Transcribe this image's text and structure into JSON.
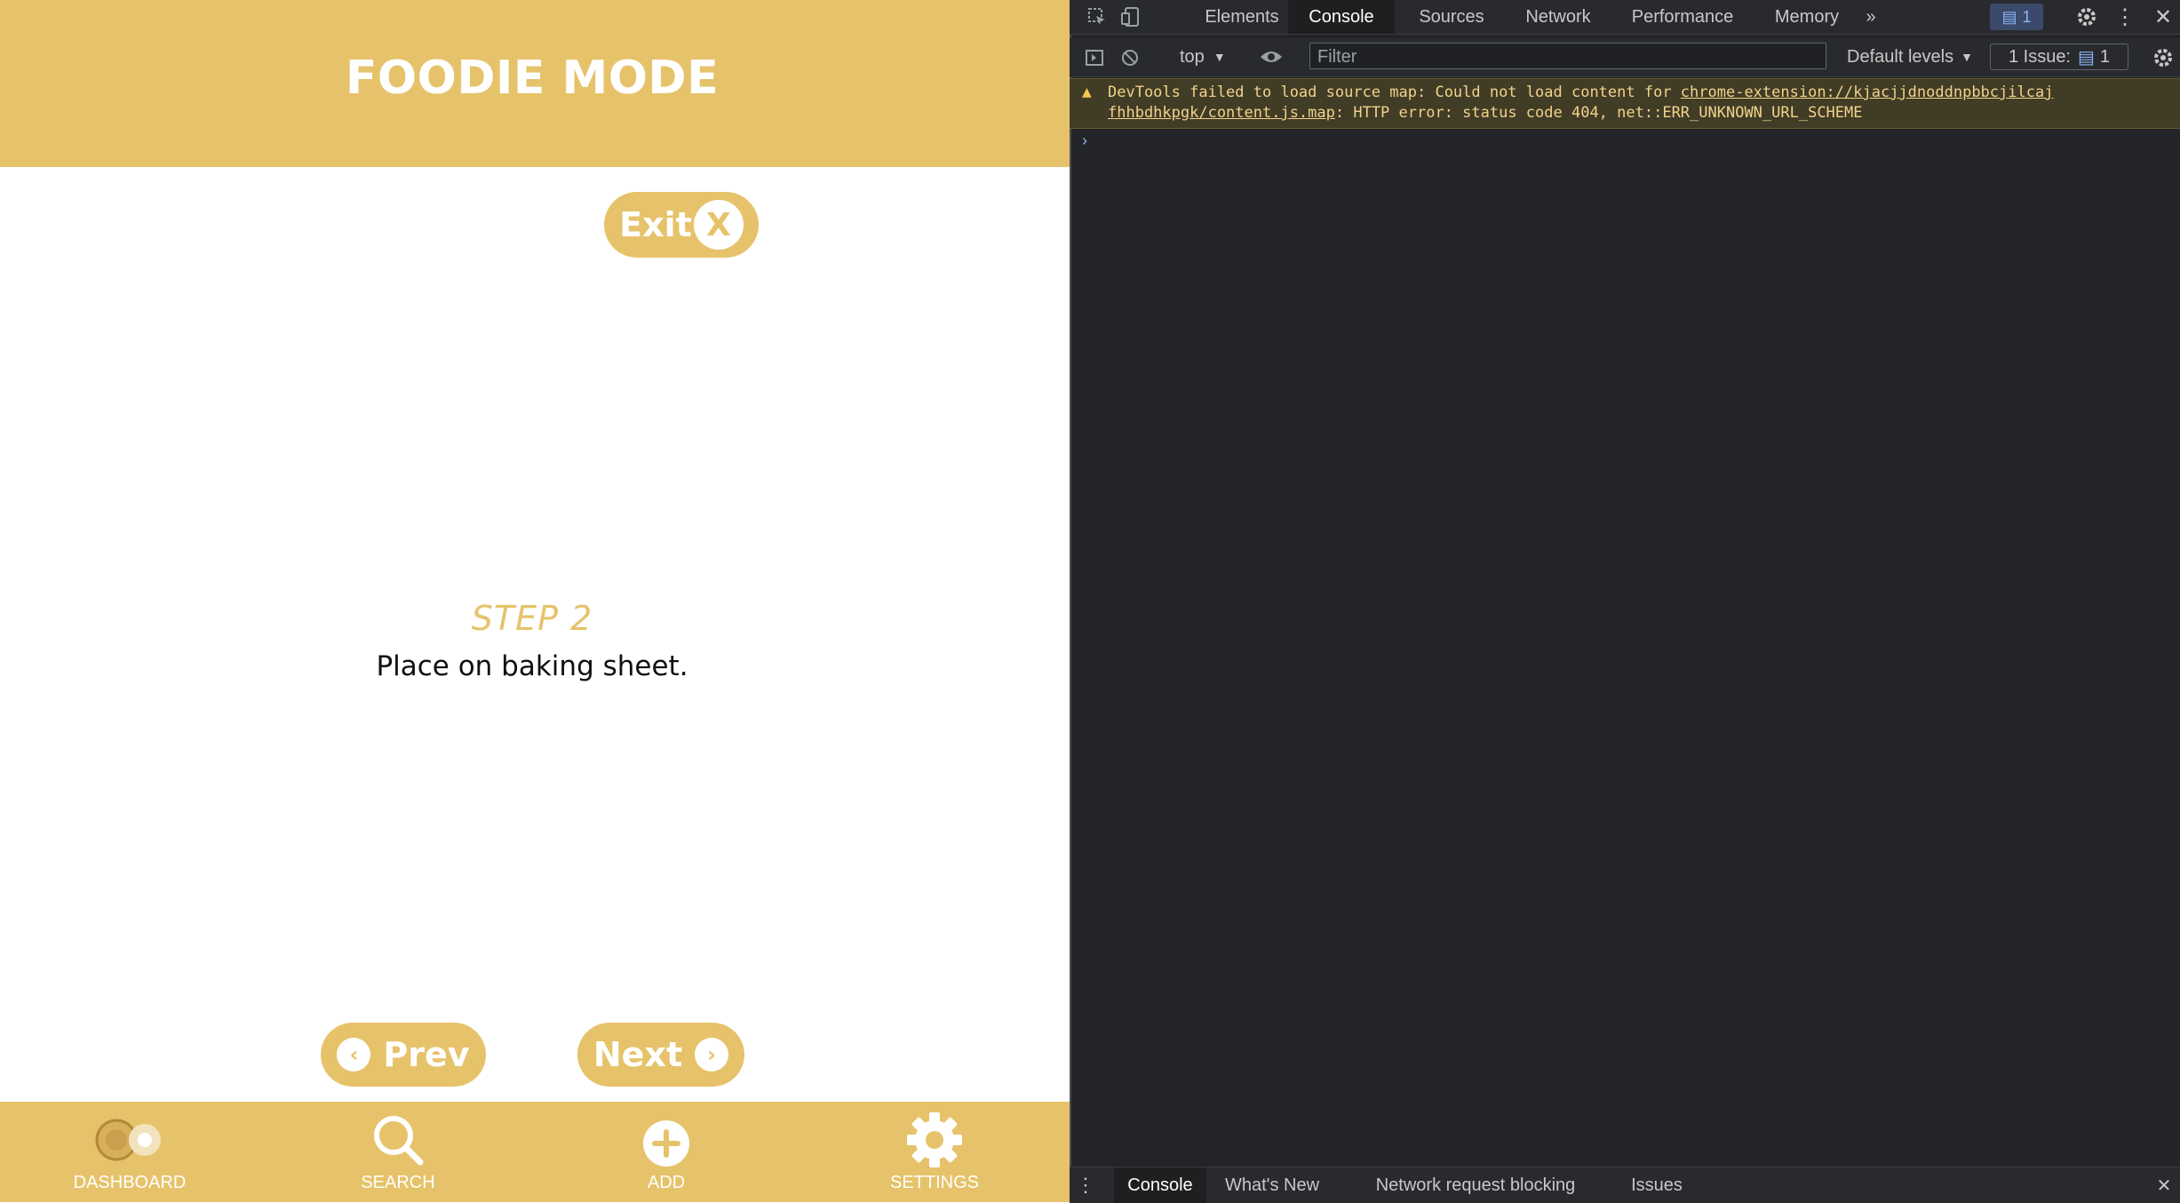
{
  "app": {
    "title": "FOODIE MODE",
    "exit_label": "Exit",
    "exit_icon": "X",
    "step_title": "STEP 2",
    "step_text": "Place on baking sheet.",
    "prev_label": "Prev",
    "next_label": "Next",
    "accent_color": "#e6c36a",
    "nav": [
      {
        "label": "DASHBOARD",
        "icon": "dashboard-icon"
      },
      {
        "label": "SEARCH",
        "icon": "search-icon"
      },
      {
        "label": "ADD",
        "icon": "add-icon"
      },
      {
        "label": "SETTINGS",
        "icon": "settings-icon"
      }
    ]
  },
  "devtools": {
    "tabs": [
      "Elements",
      "Console",
      "Sources",
      "Network",
      "Performance",
      "Memory"
    ],
    "active_tab": "Console",
    "messages_badge": "1",
    "context": "top",
    "filter_placeholder": "Filter",
    "levels": "Default levels",
    "issues_label": "1 Issue:",
    "issues_count": "1",
    "warning": {
      "prefix": "DevTools failed to load source map: Could not load content for ",
      "url_part1": "chrome-extension://kjacjjdnoddnpbbcjilcaj",
      "url_part2": "fhhbdhkpgk/content.js.map",
      "suffix": ": HTTP error: status code 404, net::ERR_UNKNOWN_URL_SCHEME"
    },
    "bottom_tabs": [
      "Console",
      "What's New",
      "Network request blocking",
      "Issues"
    ]
  }
}
